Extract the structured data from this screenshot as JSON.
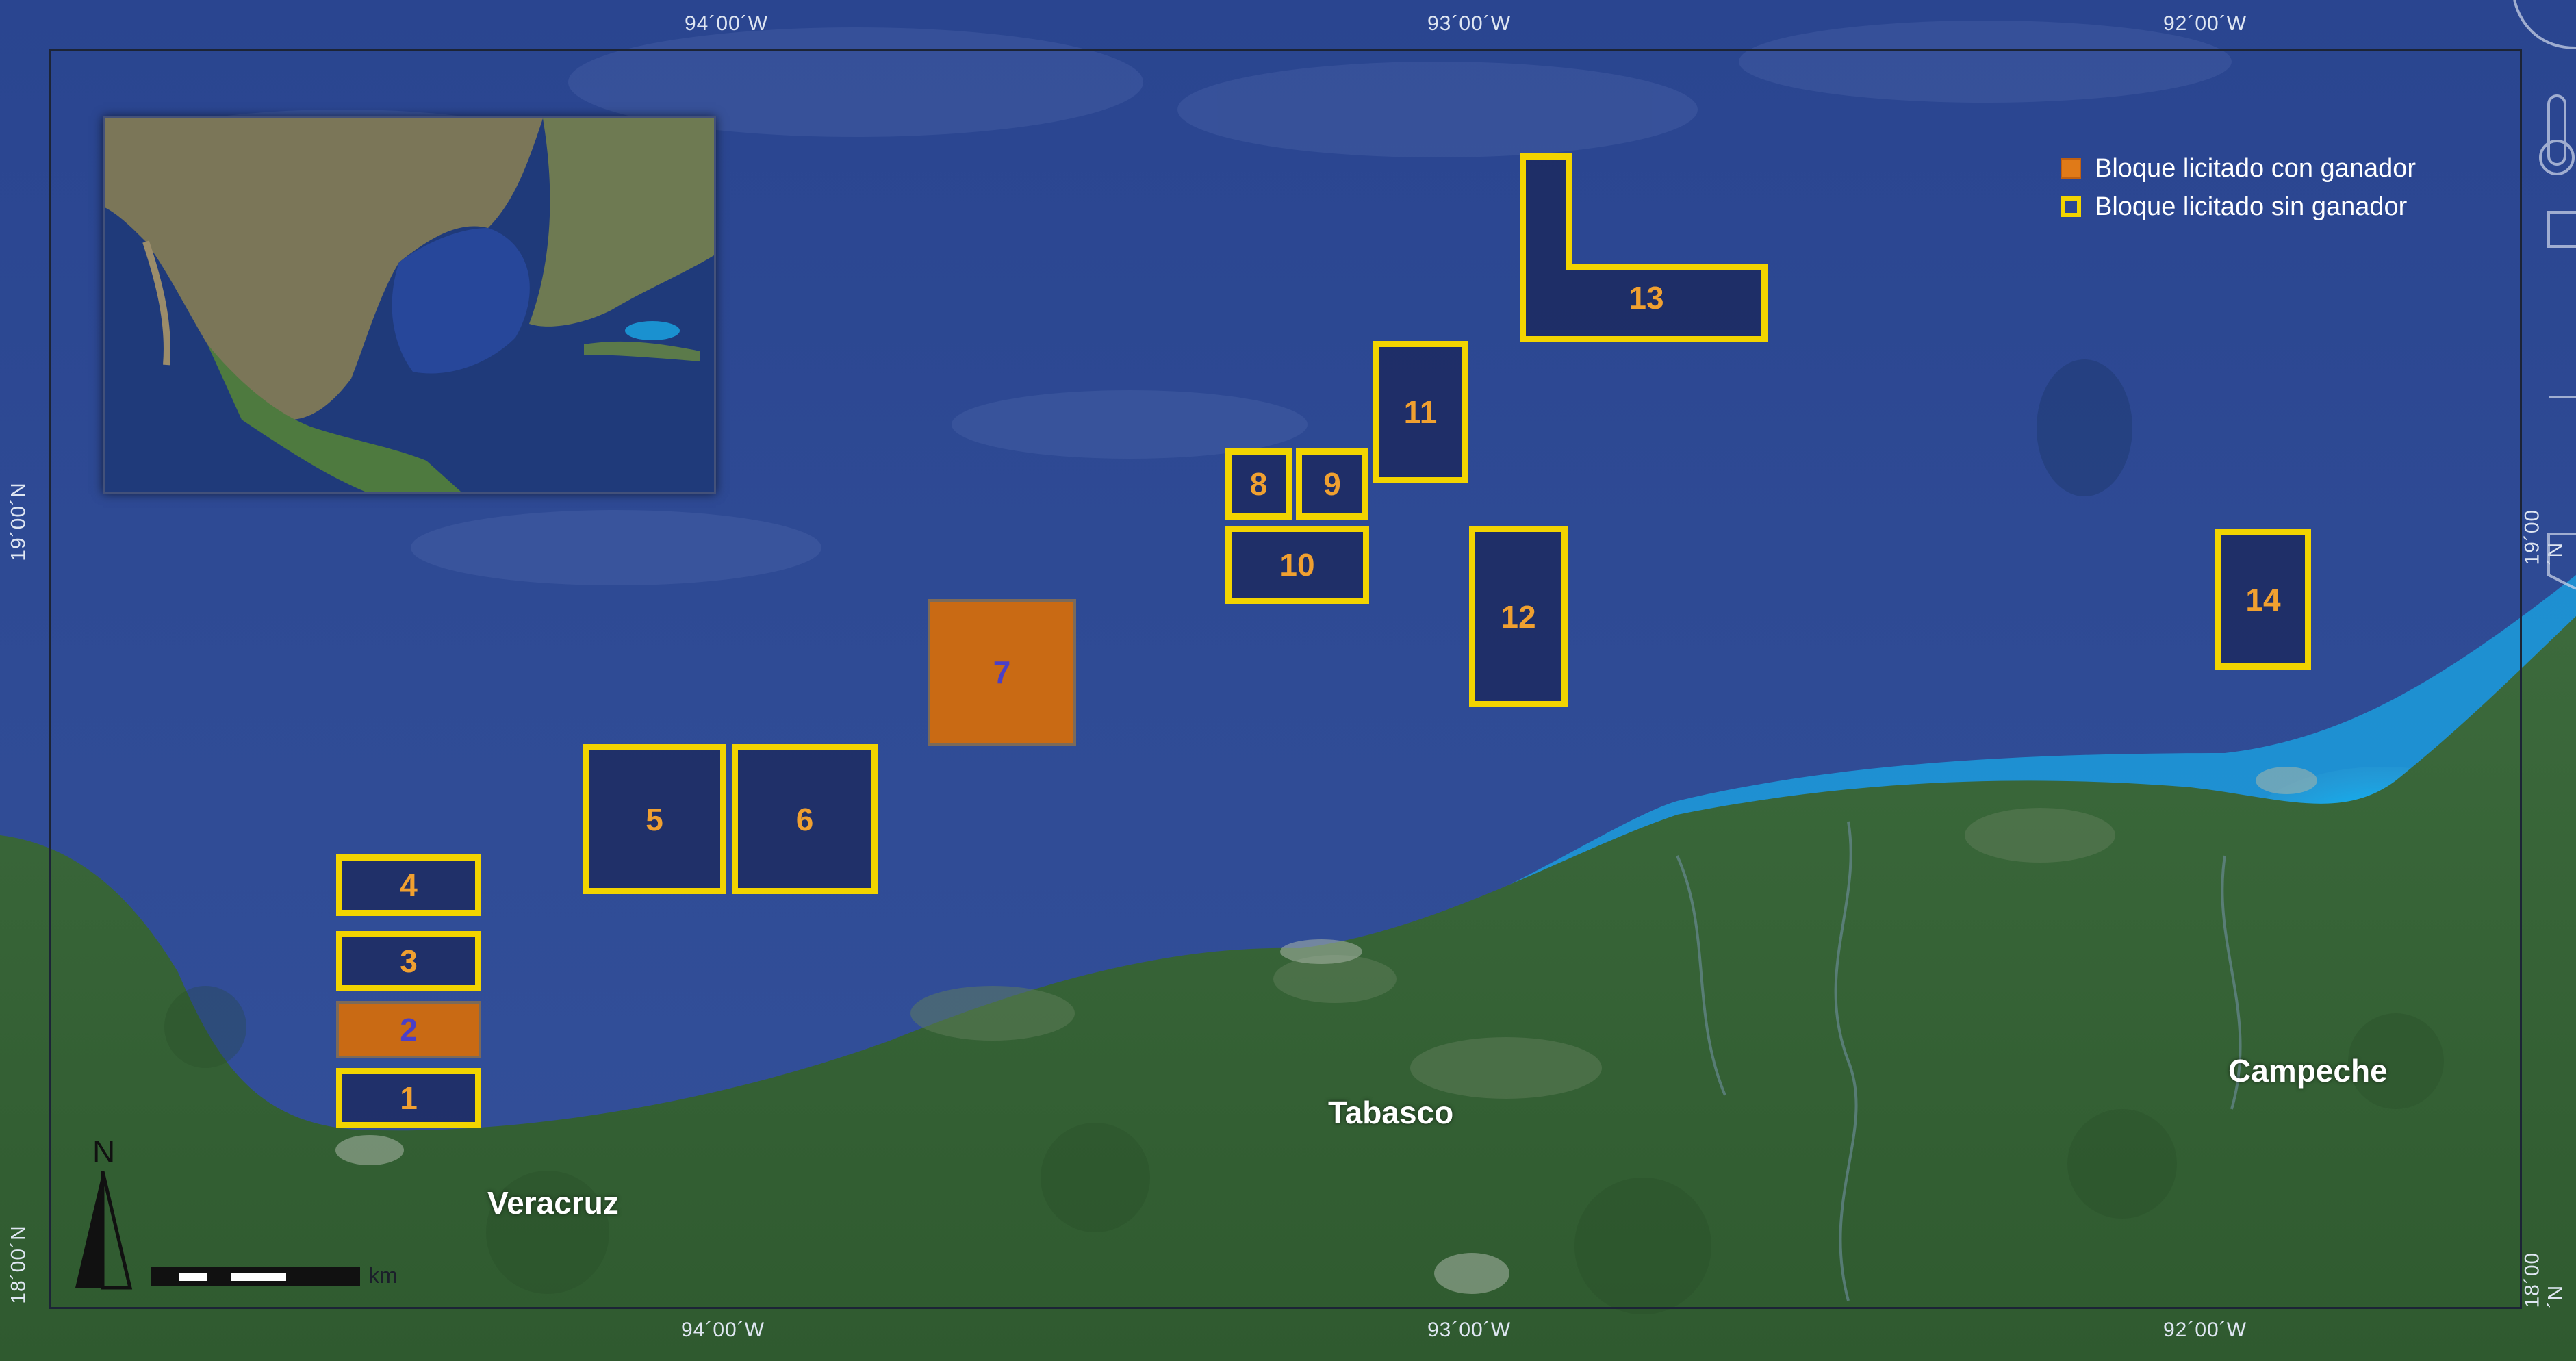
{
  "coordinates": {
    "top": [
      "94´00´W",
      "93´00´W",
      "92´00´W"
    ],
    "bottom": [
      "94´00´W",
      "93´00´W",
      "92´00´W"
    ],
    "left": [
      "19´00´N",
      "18´00´N"
    ],
    "right": [
      "19´00´N",
      "18´00´N"
    ]
  },
  "legend": {
    "won_label": "Bloque licitado con ganador",
    "not_won_label": "Bloque licitado sin ganador"
  },
  "places": {
    "veracruz": "Veracruz",
    "tabasco": "Tabasco",
    "campeche": "Campeche"
  },
  "blocks": [
    {
      "id": "1",
      "status": "sin ganador"
    },
    {
      "id": "2",
      "status": "con ganador"
    },
    {
      "id": "3",
      "status": "sin ganador"
    },
    {
      "id": "4",
      "status": "sin ganador"
    },
    {
      "id": "5",
      "status": "sin ganador"
    },
    {
      "id": "6",
      "status": "sin ganador"
    },
    {
      "id": "7",
      "status": "con ganador"
    },
    {
      "id": "8",
      "status": "sin ganador"
    },
    {
      "id": "9",
      "status": "sin ganador"
    },
    {
      "id": "10",
      "status": "sin ganador"
    },
    {
      "id": "11",
      "status": "sin ganador"
    },
    {
      "id": "12",
      "status": "sin ganador"
    },
    {
      "id": "13",
      "status": "sin ganador"
    },
    {
      "id": "14",
      "status": "sin ganador"
    }
  ],
  "north_label": "N",
  "scale_unit": "km",
  "colors": {
    "sea": "#2f4a8e",
    "land": "#3f6a3a",
    "shallow_water": "#19a7e6",
    "block_border": "#f2d400",
    "block_won_fill": "#c96a14",
    "label_orange": "#f0a030",
    "label_blue": "#4b3fc8"
  }
}
